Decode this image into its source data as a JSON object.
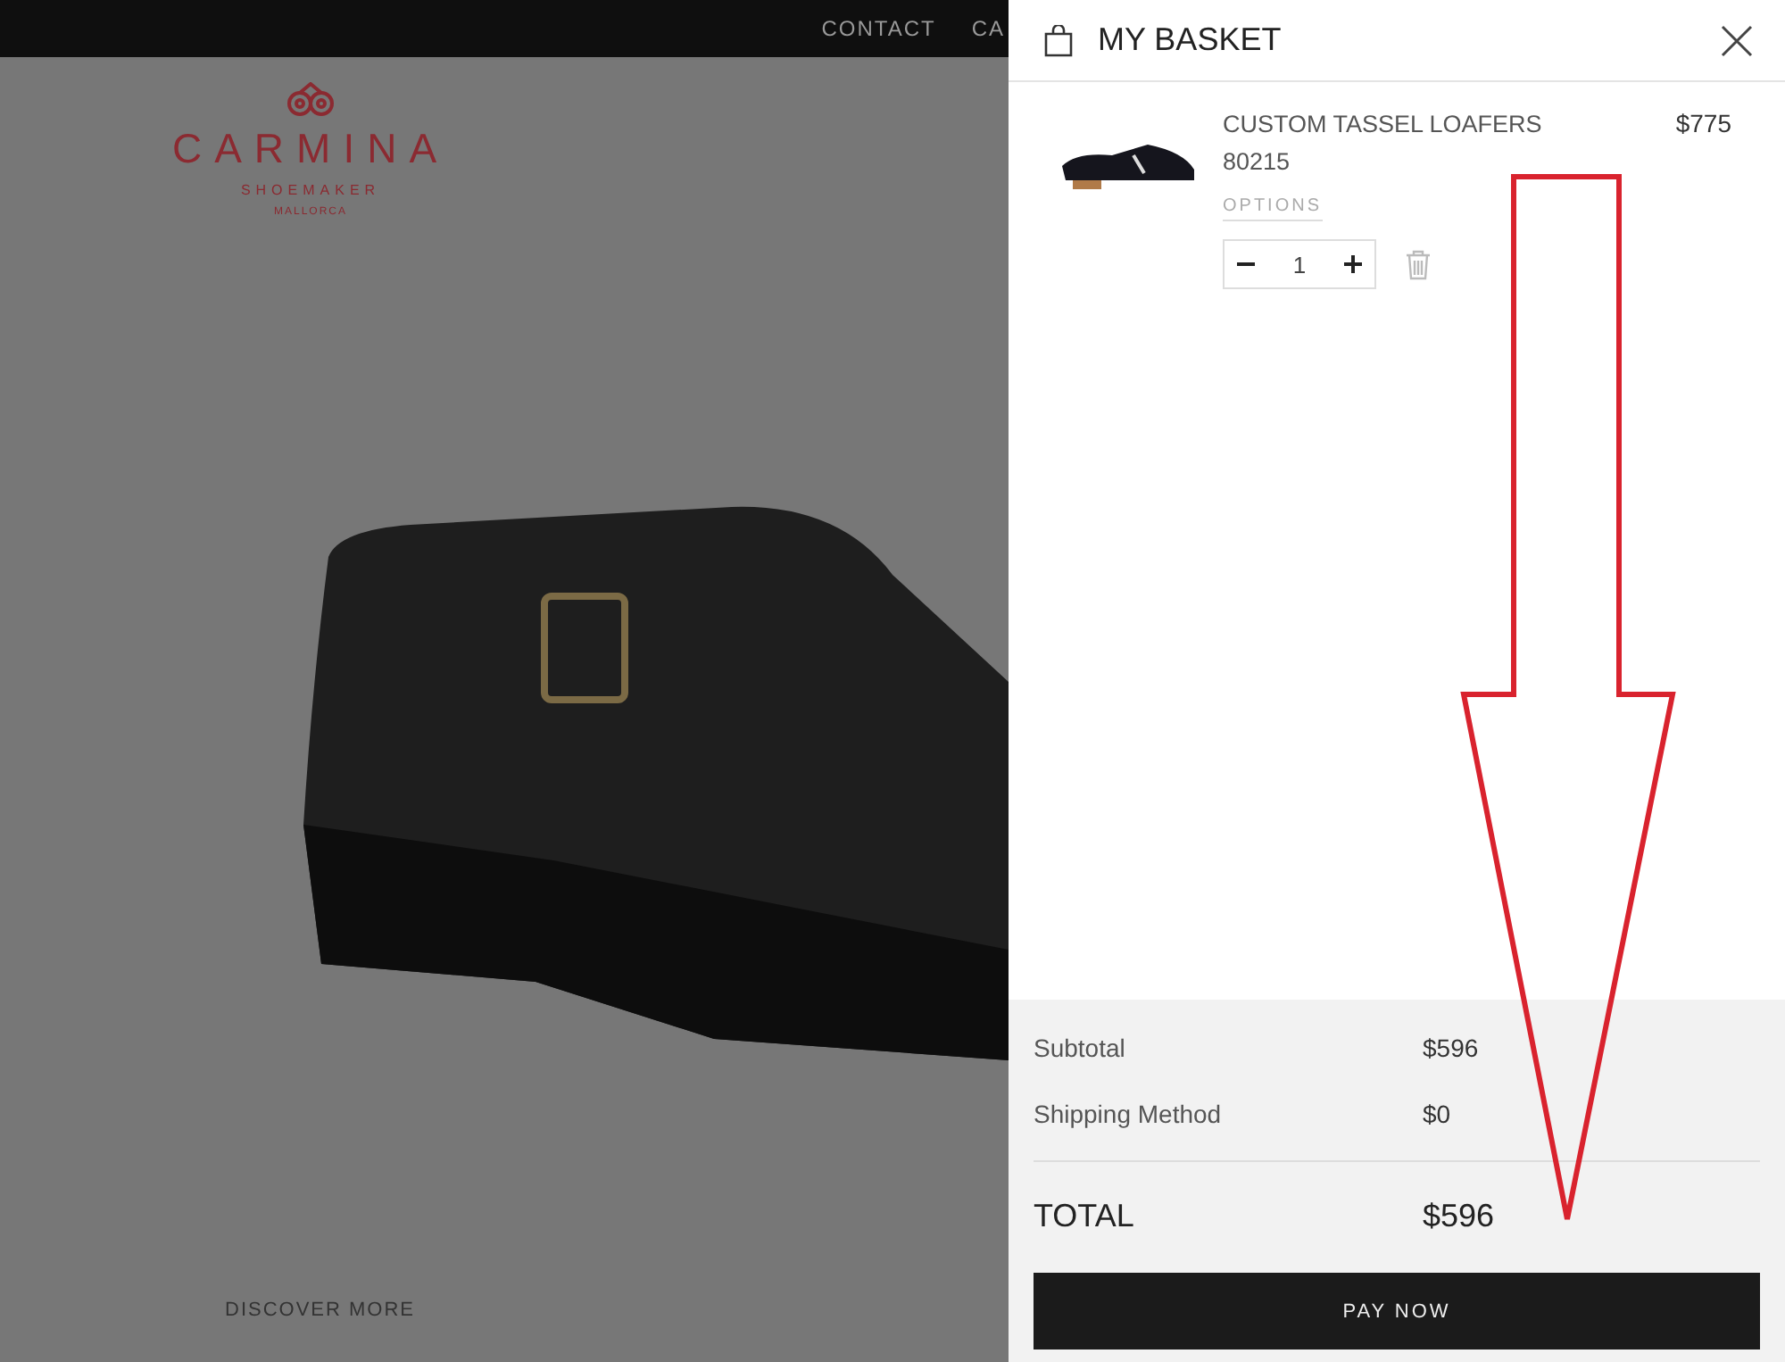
{
  "site": {
    "nav": [
      "CONTACT",
      "CA"
    ],
    "logo": {
      "name": "CARMINA",
      "tagline": "SHOEMAKER",
      "place": "MALLORCA"
    },
    "discover": "DISCOVER MORE"
  },
  "basket": {
    "title": "MY BASKET",
    "items": [
      {
        "name": "CUSTOM TASSEL LOAFERS",
        "code": "80215",
        "price": "$775",
        "options": "OPTIONS",
        "quantity": "1"
      }
    ],
    "summary": [
      {
        "label": "Subtotal",
        "value": "$596"
      },
      {
        "label": "Shipping Method",
        "value": "$0"
      }
    ],
    "total": {
      "label": "TOTAL",
      "value": "$596"
    },
    "button": "PAY NOW"
  }
}
